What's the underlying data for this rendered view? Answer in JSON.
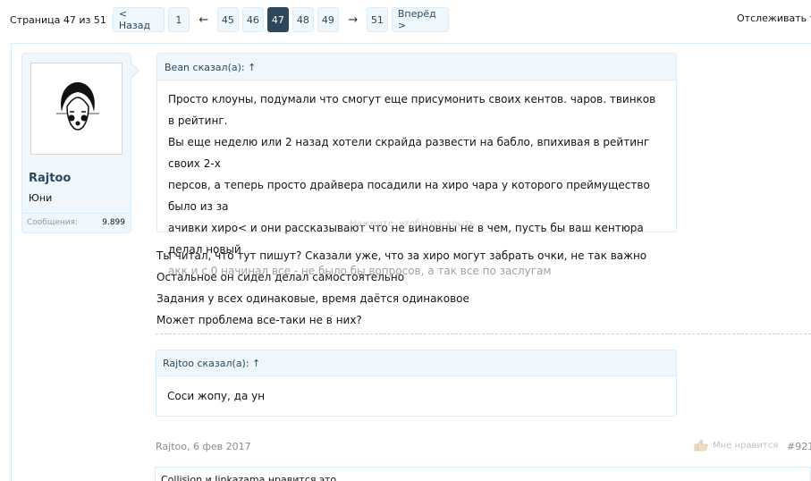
{
  "pagination": {
    "counter": "Страница 47 из 51",
    "prev": "< Назад",
    "first": "1",
    "left_arrow": "←",
    "pages": [
      "45",
      "46",
      "47",
      "48",
      "49"
    ],
    "current": "47",
    "right_arrow": "→",
    "last": "51",
    "next": "Вперёд >"
  },
  "watch_thread": "Отслеживать тем",
  "user": {
    "name": "Rajtoo",
    "title": "Юни",
    "messages_label": "Сообщения:",
    "messages_value": "9.899"
  },
  "quote1": {
    "attribution": "Bean сказал(а): ↑",
    "lines": [
      "Просто клоуны, подумали что смогут еще присумонить своих кентов. чаров. твинков в рейтинг.",
      "Вы еще неделю или 2 назад хотели скрайда развести на бабло, впихивая в рейтинг своих 2-х",
      "персов, а теперь просто драйвера посадили на хиро чара у которого преймущество было из за",
      "ачивки хиро< и они рассказывают что не виновны не в чем, пусть бы ваш кентюра делал новый",
      "акк и с 0 начинал все - не было бы вопросов, а так все по заслугам"
    ],
    "expand": "Нажмите, чтобы раскрыть..."
  },
  "body_lines": [
    "Ты читал, что тут пишут? Сказали уже, что за хиро могут забрать очки, не так важно",
    "Остальное он сидел делал самостоятельно",
    "Задания у всех одинаковые, время даётся одинаковое",
    "Может проблема все-таки не в них?"
  ],
  "quote2": {
    "attribution": "Rajtoo сказал(а): ↑",
    "text": "Соси жопу, да ун"
  },
  "footer": {
    "author_date": "Rajtoo, 6 фев 2017",
    "like": "Мне нравится",
    "post_number": "#921",
    "likes_text": "Collision и Jinkazama нравится это."
  }
}
